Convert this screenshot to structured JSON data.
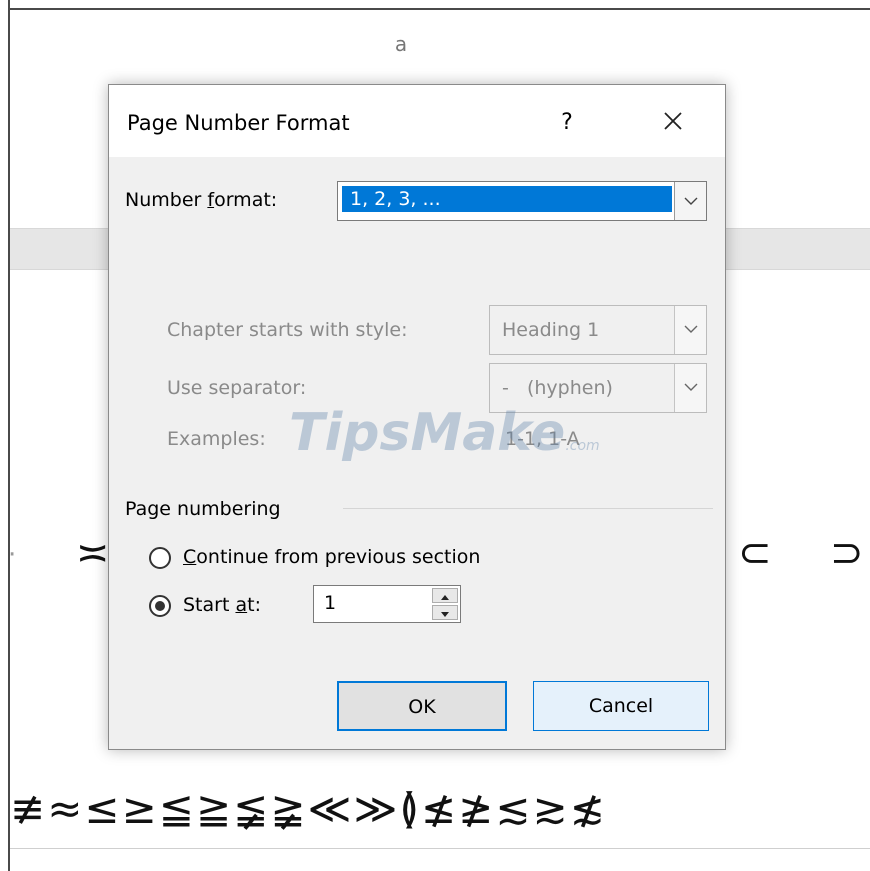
{
  "background": {
    "letter": "a",
    "symbols_mid": {
      "left_dot": "·",
      "approx": "≍",
      "subset": "⊂",
      "supset": "⊃"
    },
    "symbols_row": "≢≈≤≥≦≧≨≩≪≫≬≰≱≲≳≴"
  },
  "dialog": {
    "title": "Page Number Format",
    "help_label": "?",
    "close_icon": "close-icon",
    "number_format": {
      "label_pre": "Number ",
      "label_access": "f",
      "label_post": "ormat:",
      "value": "1, 2, 3, ..."
    },
    "chapter_style": {
      "label": "Chapter starts with style:",
      "value": "Heading 1"
    },
    "separator": {
      "label": "Use separator:",
      "value": "-   (hyphen)"
    },
    "examples": {
      "label": "Examples:",
      "value": "1-1, 1-A"
    },
    "page_numbering": {
      "heading": "Page numbering",
      "continue": {
        "label_access": "C",
        "label_rest": "ontinue from previous section",
        "selected": false
      },
      "start_at": {
        "label_pre": "Start ",
        "label_access": "a",
        "label_post": "t:",
        "selected": true,
        "value": "1"
      }
    },
    "ok_label": "OK",
    "cancel_label": "Cancel"
  },
  "watermark": {
    "text": "TipsMake",
    "suffix": ".com"
  },
  "colors": {
    "selection": "#0078d7",
    "dialog_bg": "#f0f0f0",
    "disabled_text": "#8a8a8a"
  }
}
